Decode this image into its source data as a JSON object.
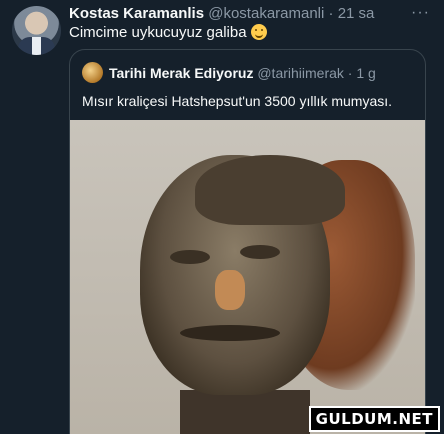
{
  "tweet": {
    "author_name": "Kostas Karamanlis",
    "handle": "@kostakaramanli",
    "separator": " · ",
    "time": "21 sa",
    "text": "Cimcime uykucuyuz galiba",
    "emoji": "smiling-face-icon",
    "more": "···"
  },
  "quoted": {
    "author_name": "Tarihi Merak Ediyoruz",
    "handle": "@tarihiimerak",
    "separator": " · ",
    "time": "1 g",
    "text": "Mısır kraliçesi Hatshepsut'un 3500 yıllık mumyası."
  },
  "watermark": "GULDUM.NET",
  "colors": {
    "background": "#15202b",
    "text": "#f7f9f9",
    "muted": "#8b98a5",
    "border": "#38444d"
  }
}
